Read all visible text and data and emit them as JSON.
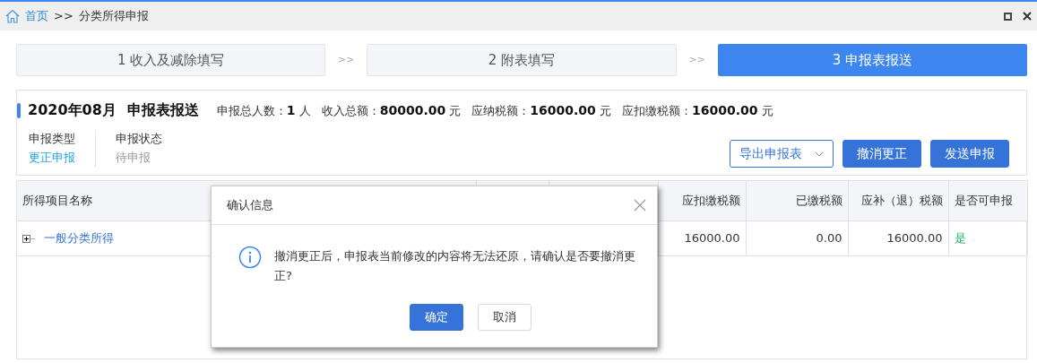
{
  "breadcrumb": {
    "home": "首页",
    "separator": ">>",
    "current": "分类所得申报"
  },
  "steps": [
    {
      "label": "1 收入及减除填写",
      "selected": false
    },
    {
      "label": "2 附表填写",
      "selected": false
    },
    {
      "label": "3 申报表报送",
      "selected": true
    }
  ],
  "step_separator": ">>",
  "summary": {
    "period": "2020年08月",
    "title": "申报表报送",
    "stats": [
      {
        "label": "申报总人数：",
        "value": "1",
        "unit": "人"
      },
      {
        "label": "收入总额：",
        "value": "80000.00",
        "unit": "元"
      },
      {
        "label": "应纳税额：",
        "value": "16000.00",
        "unit": "元"
      },
      {
        "label": "应扣缴税额：",
        "value": "16000.00",
        "unit": "元"
      }
    ],
    "fields": [
      {
        "label": "申报类型",
        "value": "更正申报",
        "kind": "link"
      },
      {
        "label": "申报状态",
        "value": "待申报",
        "kind": "muted"
      }
    ],
    "buttons": [
      {
        "label": "导出申报表",
        "kind": "dropdown"
      },
      {
        "label": "撤消更正",
        "kind": "primary"
      },
      {
        "label": "发送申报",
        "kind": "primary"
      }
    ]
  },
  "table": {
    "columns": [
      "所得项目名称",
      "",
      "",
      "应扣缴税额",
      "已缴税额",
      "应补（退）税额",
      "是否可申报"
    ],
    "rows": [
      {
        "expandable": true,
        "cells": [
          "一般分类所得",
          "",
          "",
          "16000.00",
          "0.00",
          "16000.00",
          "是"
        ]
      }
    ]
  },
  "dialog": {
    "title": "确认信息",
    "message": "撤消更正后，申报表当前修改的内容将无法还原，请确认是否要撤消更正?",
    "buttons": [
      {
        "label": "确定",
        "kind": "primary"
      },
      {
        "label": "取消",
        "kind": "default"
      }
    ]
  }
}
